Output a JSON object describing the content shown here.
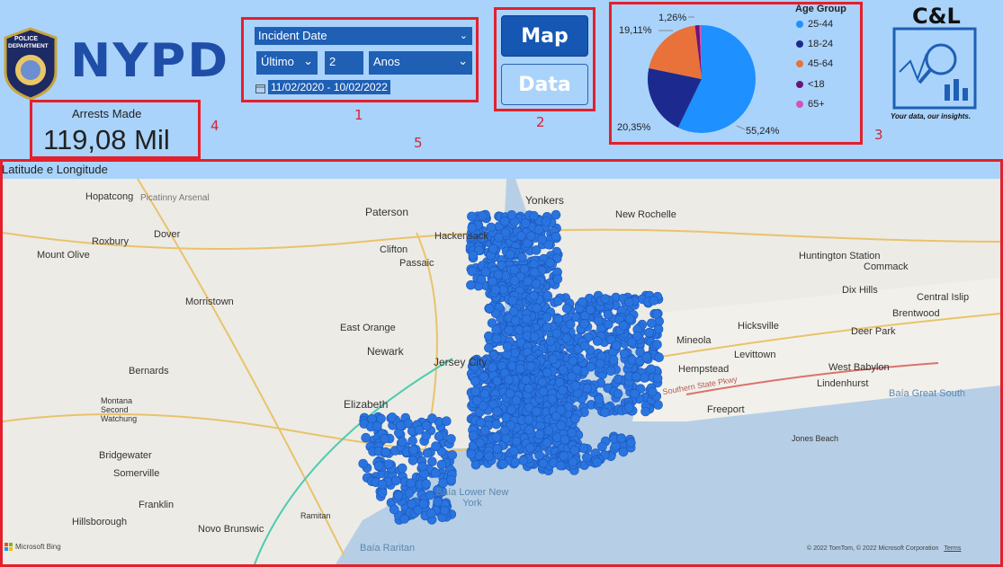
{
  "header": {
    "badge_lines": [
      "POLICE",
      "DEPARTMENT",
      "CITY OF NEW YORK"
    ],
    "nypd_logo_text": "NYPD"
  },
  "slicer": {
    "field_label": "Incident Date",
    "relative_option": "Último",
    "count": "2",
    "unit": "Anos",
    "date_range": "11/02/2020 - 10/02/2022"
  },
  "buttons": {
    "map_label": "Map",
    "data_label": "Data"
  },
  "kpi": {
    "label": "Arrests Made",
    "value": "119,08 Mil"
  },
  "annotations": [
    "1",
    "2",
    "3",
    "4",
    "5"
  ],
  "chart_data": {
    "type": "pie",
    "title": "Age Group",
    "categories": [
      "25-44",
      "18-24",
      "45-64",
      "<18",
      "65+"
    ],
    "values": [
      55.24,
      20.35,
      19.11,
      1.26,
      0.65
    ],
    "slice_labels": [
      "55,24%",
      "20,35%",
      "19,11%",
      "1,26%",
      ""
    ],
    "colors": [
      "#1e90ff",
      "#1c2a8f",
      "#e8723a",
      "#6a1578",
      "#d94fb5"
    ],
    "legend_position": "right"
  },
  "brand": {
    "logo_text": "C&L",
    "tagline": "Your data, our insights."
  },
  "map": {
    "title": "Latitude e Longitude",
    "place_labels": [
      "Yonkers",
      "New Rochelle",
      "Paterson",
      "Hackensack",
      "Clifton",
      "Passaic",
      "Huntington Station",
      "Commack",
      "Dix Hills",
      "Central Islip",
      "Brentwood",
      "Hicksville",
      "Mineola",
      "Deer Park",
      "Levittown",
      "Hempstead",
      "West Babylon",
      "Lindenhurst",
      "Freeport",
      "Jones Beach",
      "East Orange",
      "Newark",
      "Jersey City",
      "Elizabeth",
      "Hopatcong",
      "Picatinny Arsenal",
      "Dover",
      "Roxbury",
      "Mount Olive",
      "Morristown",
      "Bernards",
      "Montana Second Watchung",
      "Bridgewater",
      "Somerville",
      "Franklin",
      "Hillsborough",
      "Novo Brunswic",
      "Ramitan"
    ],
    "water_labels": [
      "Baía Great South",
      "Baía Lower New York",
      "Baía Raritan",
      "Southern State Pkwy"
    ],
    "attribution": "© 2022 TomTom, © 2022 Microsoft Corporation",
    "terms": "Terms",
    "bing": "Microsoft Bing"
  },
  "colors": {
    "page_bg": "#a9d3fb",
    "accent_red": "#e3202c",
    "slicer_blue": "#1f5fb4",
    "point_blue": "#2a74e0"
  }
}
